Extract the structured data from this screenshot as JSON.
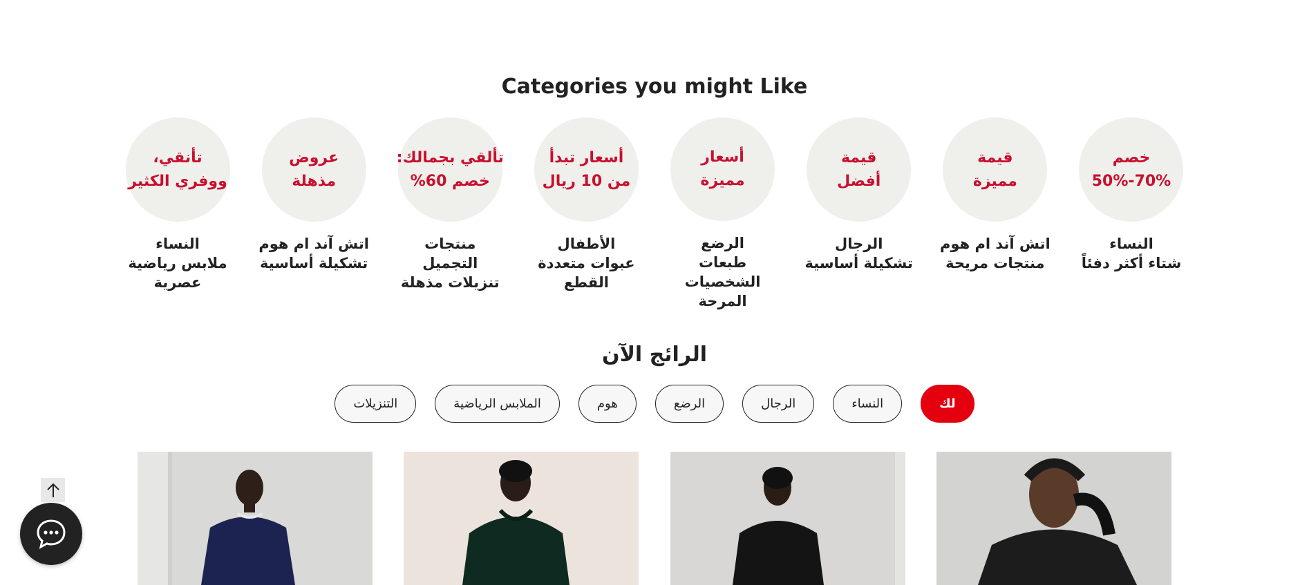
{
  "categories_section": {
    "title": "Categories you might Like",
    "items": [
      {
        "promo": [
          "خصم",
          "70%-50%"
        ],
        "label": [
          "النساء",
          "شتاء أكثر دفئاً"
        ]
      },
      {
        "promo": [
          "قيمة",
          "مميزة"
        ],
        "label": [
          "اتش آند ام هوم",
          "منتجات مريحة"
        ]
      },
      {
        "promo": [
          "قيمة",
          "أفضل"
        ],
        "label": [
          "الرجال",
          "تشكيلة أساسية"
        ]
      },
      {
        "promo": [
          "أسعار",
          "مميزة"
        ],
        "label": [
          "الرضع",
          "طبعات",
          "الشخصيات",
          "المرحة"
        ]
      },
      {
        "promo": [
          "أسعار تبدأ",
          "من 10 ريال"
        ],
        "label": [
          "الأطفال",
          "عبوات متعددة",
          "القطع"
        ]
      },
      {
        "promo": [
          "تألقي بجمالك:",
          "خصم 60%"
        ],
        "label": [
          "منتجات التجميل",
          "تنزيلات مذهلة"
        ]
      },
      {
        "promo": [
          "عروض",
          "مذهلة"
        ],
        "label": [
          "اتش آند ام هوم",
          "تشكيلة أساسية"
        ]
      },
      {
        "promo": [
          "تأنقي،",
          "ووفري الكثير"
        ],
        "label": [
          "النساء",
          "ملابس رياضية",
          "عصرية"
        ]
      }
    ],
    "promo_color": "#c8102e",
    "circle_color": "#efefec"
  },
  "trending_section": {
    "title": "الرائج الآن",
    "filters": [
      {
        "label": "لك",
        "active": true
      },
      {
        "label": "النساء",
        "active": false
      },
      {
        "label": "الرجال",
        "active": false
      },
      {
        "label": "الرضع",
        "active": false
      },
      {
        "label": "هوم",
        "active": false
      },
      {
        "label": "الملابس الرياضية",
        "active": false
      },
      {
        "label": "التنزيلات",
        "active": false
      }
    ],
    "active_color": "#e50010"
  },
  "products": [
    {
      "icon": "model-black-puffer-jacket-image"
    },
    {
      "icon": "model-black-hoodie-image"
    },
    {
      "icon": "model-dark-green-hoodie-image"
    },
    {
      "icon": "model-navy-sweatshirt-image"
    }
  ],
  "floating": {
    "scroll_top_icon": "arrow-up-icon",
    "chat_icon": "chat-bubble-icon"
  }
}
